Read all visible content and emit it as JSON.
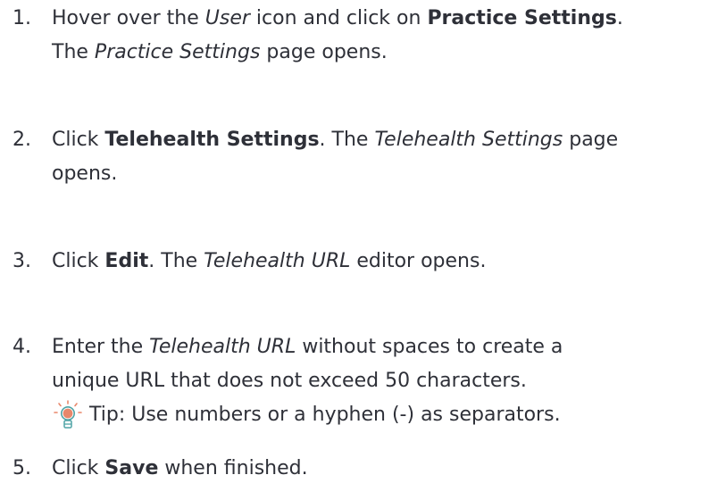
{
  "steps": [
    {
      "num": "1.",
      "line1_pre": "Hover over the ",
      "line1_em": "User",
      "line1_mid": " icon and click on ",
      "line1_bold": "Practice Settings",
      "line1_post": ".",
      "line2_pre": "The ",
      "line2_em": "Practice Settings",
      "line2_post": " page opens."
    },
    {
      "num": "2.",
      "line1_pre": "Click ",
      "line1_bold": "Telehealth Settings",
      "line1_mid": ". The ",
      "line1_em": "Telehealth Settings",
      "line1_post": " page",
      "line2": "opens."
    },
    {
      "num": "3.",
      "pre": "Click ",
      "bold": "Edit",
      "mid": ". The ",
      "em": "Telehealth URL",
      "post": " editor opens."
    },
    {
      "num": "4.",
      "line1_pre": "Enter the ",
      "line1_em": "Telehealth URL",
      "line1_post": " without spaces to create a",
      "line2": "unique URL that does not exceed 50 characters.",
      "tip": "Tip: Use numbers or a hyphen (-) as separators.",
      "tip_icon": "lightbulb-icon"
    },
    {
      "num": "5.",
      "pre": "Click ",
      "bold": "Save",
      "post": " when finished."
    }
  ],
  "colors": {
    "text": "#2e3038",
    "bulb": "#e8876b",
    "bulb_outline": "#4fa3a5"
  }
}
